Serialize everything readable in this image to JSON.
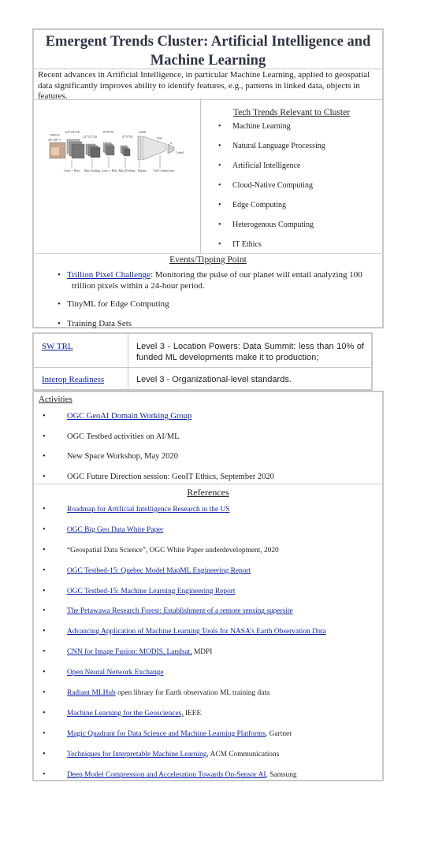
{
  "title": "Emergent Trends Cluster: Artificial Intelligence and Machine Learning",
  "intro": "Recent advances in Artificial Intelligence, in particular Machine Learning, applied to geospatial data significantly improves ability to identify features, e.g., patterns in linked data, objects in features.",
  "figure": {
    "input_label_1": "INPUT",
    "input_label_2": "28*28*3",
    "dims": [
      "24*24*20",
      "12*12*20",
      "8*8*50",
      "4*4*50",
      "3200",
      "500",
      "2"
    ],
    "layers": [
      "Conv + Relu",
      "Max Pooling",
      "Conv + Relu",
      "Max Pooling",
      "Flatten",
      "Full Connection"
    ],
    "output_label": "Label"
  },
  "tech_trends": {
    "heading": "Tech Trends Relevant to Cluster",
    "items": [
      "Machine Learning",
      "Natural Language Processing",
      "Artificial Intelligence",
      "Cloud-Native Computing",
      "Edge Computing",
      "Heterogenous Computing",
      "IT Ethics"
    ]
  },
  "events": {
    "heading": "Events/Tipping Point",
    "item1_link": "Trillion Pixel Challenge",
    "item1_text_a": ": Monitoring the pulse of our planet will entail analyzing 100",
    "item1_text_b": "trillion pixels within a 24-hour period.",
    "item2": "TinyML for Edge Computing",
    "item3": "Training Data Sets"
  },
  "trl": {
    "sw_trl_label": "SW TRL",
    "sw_trl_value": "Level 3 - Location Powers: Data Summit: less than 10% of funded ML developments make it to production;",
    "interop_label": "Interop Readiness",
    "interop_value": "Level 3 - Organizational-level standards."
  },
  "activities": {
    "heading": "Activities",
    "items": [
      {
        "text": "OGC GeoAI Domain Working Group",
        "link": true
      },
      {
        "text": "OGC Testbed activities on AI/ML",
        "link": false
      },
      {
        "text": "New Space Workshop, May 2020",
        "link": false
      },
      {
        "text": "OGC Future Direction session: GeoIT Ethics, September 2020",
        "link": false
      }
    ]
  },
  "references": {
    "heading": "References",
    "items": [
      {
        "link": "Roadmap for Artificial Intelligence Research in the US",
        "text": ""
      },
      {
        "link": "OGC Big Geo Data White Paper",
        "text": ""
      },
      {
        "link": "",
        "text": "“Geospatial Data Science”, OGC White Paper underdevelopment, 2020"
      },
      {
        "link": "OGC Testbed-15: Quebec Model MapML Engineering Report",
        "text": ""
      },
      {
        "link": "OGC Testbed-15: Machine Learning Engineering Report",
        "text": ""
      },
      {
        "link": "The Petawawa Research Forest: Establishment of a remote sensing supersite",
        "text": ""
      },
      {
        "link": "Advancing Application of Machine Learning Tools for NASA’s Earth Observation Data",
        "text": ""
      },
      {
        "link": "CNN for Image Fusion: MODIS, Landsat,",
        "text": " MDPI"
      },
      {
        "link": "Open Neural Network Exchange",
        "text": ""
      },
      {
        "link": "Radiant MLHub",
        "text": " open library for Earth observation ML training data"
      },
      {
        "link": "Machine Learning for the Geosciences,",
        "text": " IEEE"
      },
      {
        "link": "Magic Quadrant for Data Science and Machine Learning Platforms",
        "text": ", Gartner"
      },
      {
        "link": "Techniques for Interpretable Machine Learning",
        "text": ", ACM Communications"
      },
      {
        "link": "Deep Model Compression and Acceleration Towards On-Sensor AI",
        "text": ", Samsung"
      }
    ]
  },
  "colors": {
    "link": "#0b1fa8",
    "border": "#c8c8c8",
    "title": "#2f3347"
  }
}
